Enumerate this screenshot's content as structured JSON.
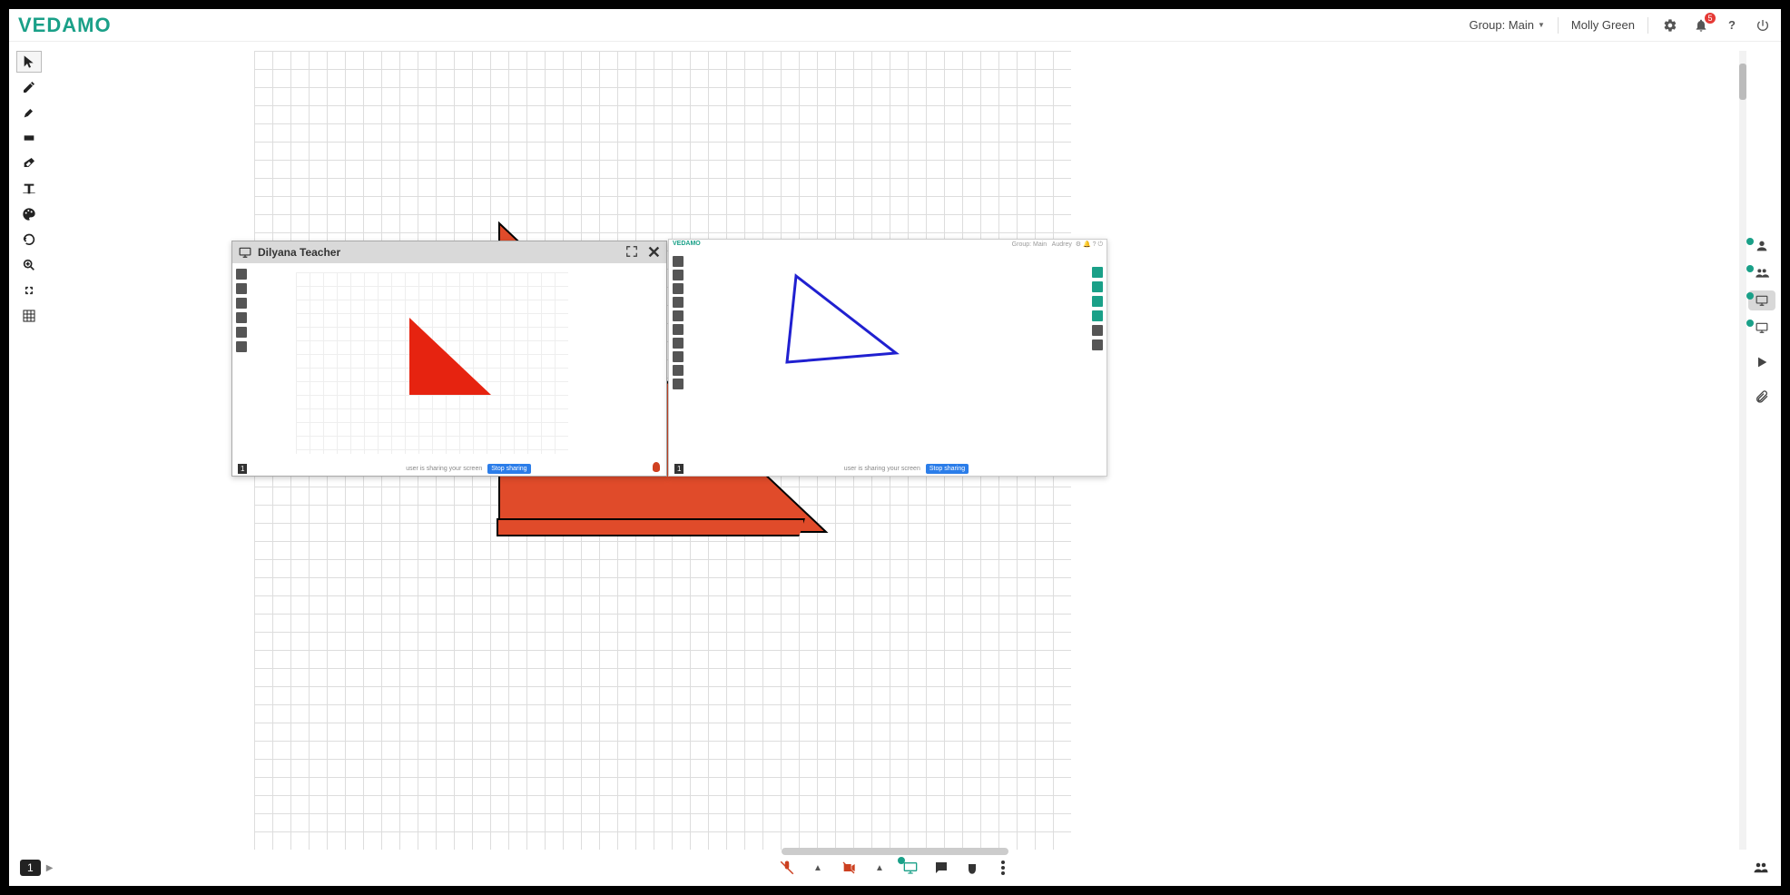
{
  "logo": "VEDAMO",
  "header": {
    "group_label": "Group: Main",
    "user_name": "Molly Green",
    "notification_count": "5"
  },
  "float_window": {
    "title": "Dilyana Teacher",
    "stop_sharing": "Stop sharing",
    "sharing_msg": "user is sharing your screen"
  },
  "mini_right": {
    "logo": "VEDAMO",
    "group": "Group: Main",
    "user": "Audrey"
  },
  "bottom": {
    "page": "1"
  },
  "colors": {
    "accent": "#1aa088",
    "triangle_red": "#e04b2a",
    "triangle_blue": "#2020d0"
  }
}
